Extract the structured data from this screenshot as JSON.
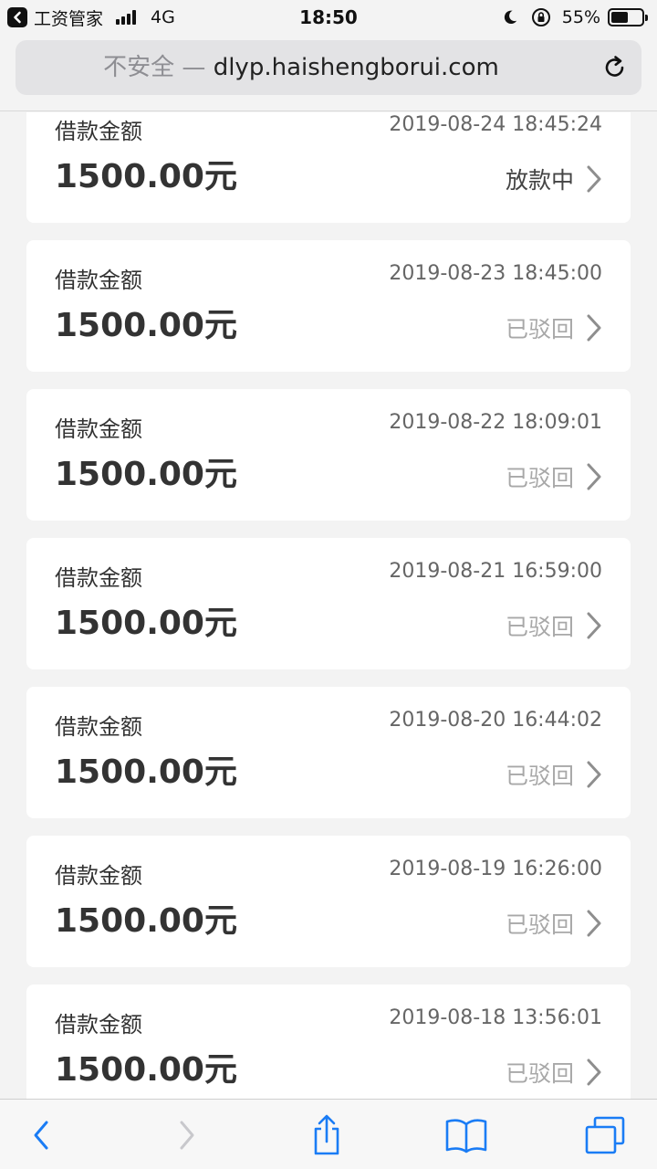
{
  "status_bar": {
    "back_app": "工资管家",
    "network": "4G",
    "time": "18:50",
    "battery": "55%",
    "battery_level": 0.55
  },
  "address_bar": {
    "insecure_label": "不安全 —",
    "host": "dlyp.haishengborui.com"
  },
  "records": [
    {
      "label": "借款金额",
      "time": "2019-08-24 18:45:24",
      "amount": "1500.00元",
      "status": "放款中"
    },
    {
      "label": "借款金额",
      "time": "2019-08-23 18:45:00",
      "amount": "1500.00元",
      "status": "已驳回"
    },
    {
      "label": "借款金额",
      "time": "2019-08-22 18:09:01",
      "amount": "1500.00元",
      "status": "已驳回"
    },
    {
      "label": "借款金额",
      "time": "2019-08-21 16:59:00",
      "amount": "1500.00元",
      "status": "已驳回"
    },
    {
      "label": "借款金额",
      "time": "2019-08-20 16:44:02",
      "amount": "1500.00元",
      "status": "已驳回"
    },
    {
      "label": "借款金额",
      "time": "2019-08-19 16:26:00",
      "amount": "1500.00元",
      "status": "已驳回"
    },
    {
      "label": "借款金额",
      "time": "2019-08-18 13:56:01",
      "amount": "1500.00元",
      "status": "已驳回"
    }
  ],
  "colors": {
    "accent": "#1a7cf5",
    "disabled": "#c8c8cc"
  }
}
